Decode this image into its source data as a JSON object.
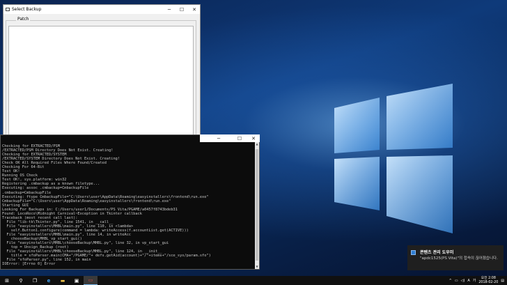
{
  "select_backup_window": {
    "title": "Select Backup",
    "group_label": "Patch",
    "minimize": "─",
    "maximize": "☐",
    "close": "✕"
  },
  "console_window": {
    "minimize": "─",
    "maximize": "☐",
    "close": "✕",
    "lines": [
      "Checking for EXTRACTED/PSM",
      "/EXTRACTED/PSM Directory Does Not Exist. Creating!",
      "Checking for EXTRACTED/SYSTEM",
      "/EXTRACTED/SYSTEM Directory Does Not Exist. Creating!",
      "Check OK All Required Files Where Found/Created",
      "Checking For 64-Bit",
      "Test OK!",
      "Running OS Check",
      "Test OK!, sys.platform: win32",
      "Registering .cmbackup as a known filetype...",
      "Executing: assoc .cmbackup=CmbackupFile",
      ".cmbackup=CmbackupFile",
      "Executing: ftype CmbackupFile=\"C:\\Users\\user\\AppData\\Roaming\\easyinstallers\\frontend\\run.exe\"",
      "CmbackupFile=\"C:\\Users\\user\\AppData\\Roaming\\easyinstallers\\frontend\\run.exe\"",
      "Starting GUI",
      "Looking For Backups in: C:/Users/user1/Documents/PS Vita/PGAME/a0457f8743bdeb31",
      "Found: LocoRoco\\Midnight Carnival~Exception in Tkinter callback",
      "Traceback (most recent call last):",
      "  File \"lib-tk\\Tkinter.py\", line 1541, in __call__",
      "  File \"easyinstallers\\MHBL\\main.py\", line 110, in <lambda>",
      "    self.Button1.configure(command = lambda: writeAccess(f.accountList.get(ACTIVE)))",
      "  File \"easyinstallers\\MHBL\\main.py\", line 14, in writeAcc",
      "    chooseBackup\\MHBL_vp_start_gui()",
      "  File \"easyinstallers\\MHBL\\chooseBackup\\MHBL.py\", line 32, in vp_start_gui",
      "    top = Unsign_Backup (root)",
      "  File \"easyinstallers\\MHBL\\chooseBackup\\MHBL.py\", line 124, in __init__",
      "    title = sfoParser.main(CMA+\"/PGAME/\"+ defs.getAid(account)+\"/\"+items+\"/sce_sys/param.sfo\")",
      "  File \"sfoParser.py\", line 152, in main",
      "IOError: [Errno 0] Error"
    ]
  },
  "toast": {
    "title": "콘텐츠 관리 도우미",
    "body": "\"apdc1525(PS Vita)\"의 접속이 끊어졌습니다."
  },
  "taskbar": {
    "start": "⊞",
    "search": "⚲",
    "task_view": "❐",
    "edge": "e",
    "explorer": "▬",
    "store": "▣",
    "app": "▭",
    "ime": "A",
    "lang": "가",
    "time": "오전 2:08",
    "date": "2018-02-20"
  },
  "colors": {
    "console_bg": "#0c0c0c",
    "console_text": "#c8c8c8",
    "taskbar_bg": "#101010",
    "accent": "#76b9ed"
  }
}
